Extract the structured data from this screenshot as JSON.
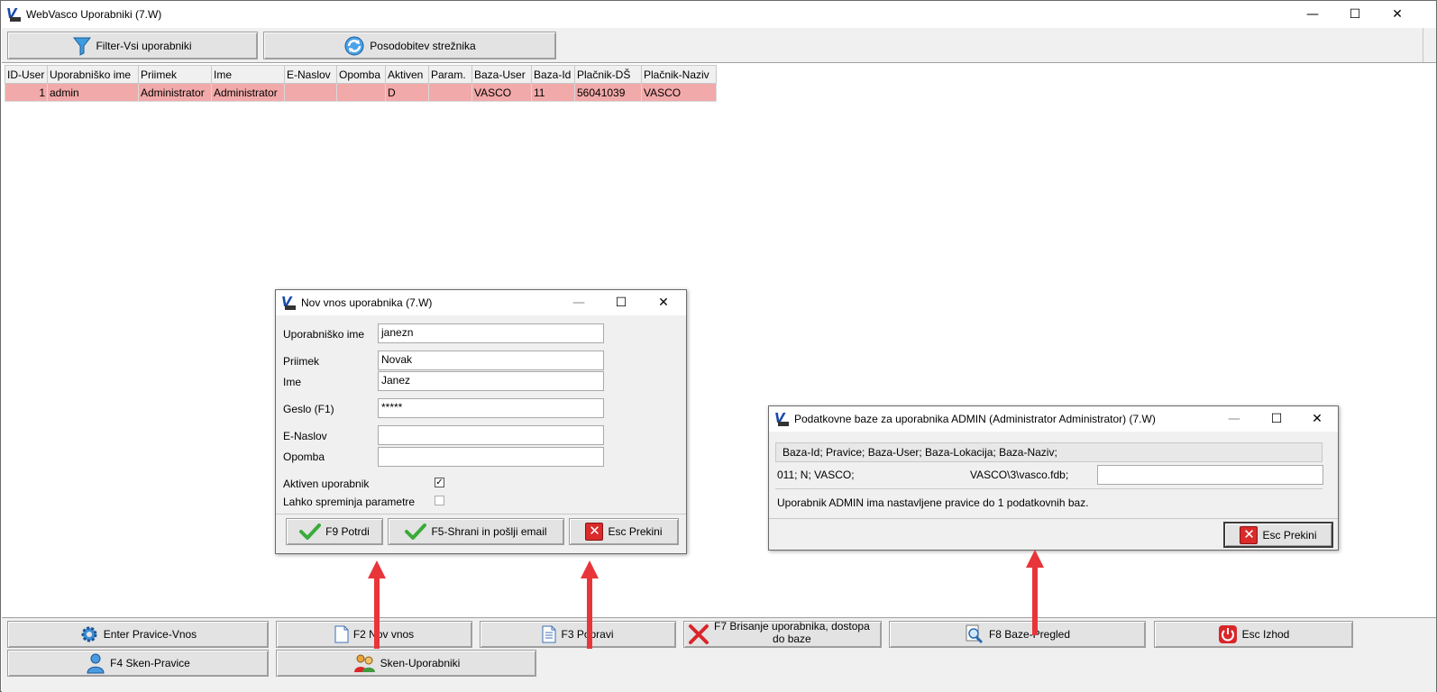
{
  "main": {
    "title": "WebVasco Uporabniki  (7.W)",
    "toolbar": {
      "filter_label": "Filter-Vsi uporabniki",
      "refresh_label": "Posodobitev strežnika"
    },
    "table": {
      "columns": [
        "ID-User",
        "Uporabniško ime",
        "Priimek",
        "Ime",
        "E-Naslov",
        "Opomba",
        "Aktiven",
        "Param.",
        "Baza-User",
        "Baza-Id",
        "Plačnik-DŠ",
        "Plačnik-Naziv"
      ],
      "rows": [
        [
          "1",
          "admin",
          "Administrator",
          "Administrator",
          "",
          "",
          "D",
          "",
          "VASCO",
          "11",
          "56041039",
          "VASCO"
        ]
      ]
    },
    "bottom_buttons": {
      "rights_entry": "Enter Pravice-Vnos",
      "new_entry": "F2 Nov vnos",
      "edit": "F3 Popravi",
      "delete_line1": "F7 Brisanje uporabnika, dostopa",
      "delete_line2": "do baze",
      "db_view": "F8 Baze-Pregled",
      "exit": "Esc Izhod",
      "scan_rights": "F4 Sken-Pravice",
      "scan_users": "Sken-Uporabniki"
    }
  },
  "new_user_dialog": {
    "title": "Nov vnos uporabnika  (7.W)",
    "username_label": "Uporabniško ime",
    "username_value": "janezn",
    "surname_label": "Priimek",
    "surname_value": "Novak",
    "name_label": "Ime",
    "name_value": "Janez",
    "password_label": "Geslo (F1)",
    "password_value": "*****",
    "email_label": "E-Naslov",
    "email_value": "",
    "note_label": "Opomba",
    "note_value": "",
    "active_label": "Aktiven uporabnik",
    "active_checked": true,
    "params_label": "Lahko spreminja parametre",
    "params_checked": false,
    "confirm_label": "F9 Potrdi",
    "save_email_label": "F5-Shrani in pošlji email",
    "cancel_label": "Esc Prekini"
  },
  "db_dialog": {
    "title": "Podatkovne baze za uporabnika ADMIN (Administrator Administrator)  (7.W)",
    "header": "Baza-Id; Pravice; Baza-User; Baza-Lokacija; Baza-Naziv;",
    "row_left": "011;   N;   VASCO;",
    "row_right": "VASCO\\3\\vasco.fdb;",
    "row_input": "",
    "info": "Uporabnik ADMIN ima nastavljene pravice do 1 podatkovnih baz.",
    "cancel_label": "Esc Prekini"
  },
  "colors": {
    "selected_row": "#f2a9a9",
    "annotation_arrow": "#e8353a",
    "dialog_bg": "#f0f0f0"
  }
}
